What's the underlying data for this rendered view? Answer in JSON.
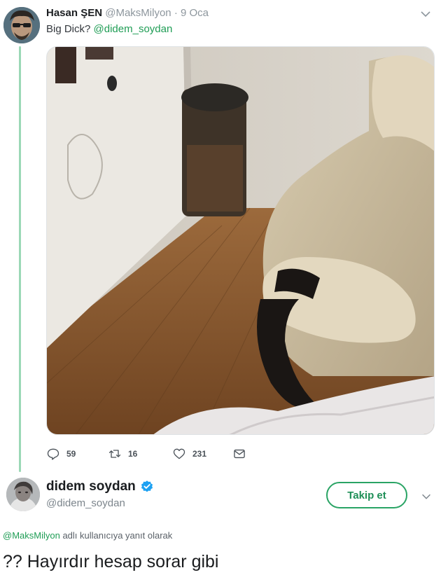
{
  "tweet": {
    "author_name": "Hasan ŞEN",
    "author_handle": "@MaksMilyon",
    "separator": "·",
    "date": "9 Oca",
    "text_prefix": "Big Dick?",
    "text_mention": "@didem_soydan",
    "stats": {
      "replies": "59",
      "retweets": "16",
      "likes": "231"
    }
  },
  "reply": {
    "author_name": "didem soydan",
    "author_handle": "@didem_soydan",
    "follow_label": "Takip et",
    "reply_to_mention": "@MaksMilyon",
    "reply_to_suffix": "adlı kullanıcıya yanıt olarak",
    "text": "?? Hayırdır hesap sorar gibi"
  },
  "colors": {
    "accent_green": "#1f9d55",
    "thread_line": "#9bd8b6",
    "verified_blue": "#1da1f2",
    "secondary_text": "#8d969d"
  },
  "icons": [
    "chevron-down-icon",
    "reply-icon",
    "retweet-icon",
    "heart-icon",
    "message-icon",
    "verified-badge-icon"
  ]
}
